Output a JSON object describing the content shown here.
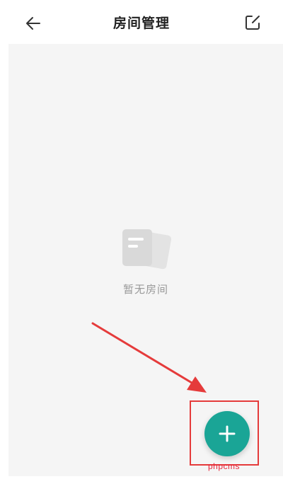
{
  "header": {
    "title": "房间管理",
    "back_icon": "arrow-left-icon",
    "edit_icon": "edit-square-icon"
  },
  "empty_state": {
    "icon": "empty-document-icon",
    "text": "暂无房间"
  },
  "fab": {
    "icon": "plus-icon",
    "color": "#1aa596"
  },
  "annotation": {
    "color": "#e53b3b"
  },
  "watermark": {
    "text": "phpcms"
  }
}
